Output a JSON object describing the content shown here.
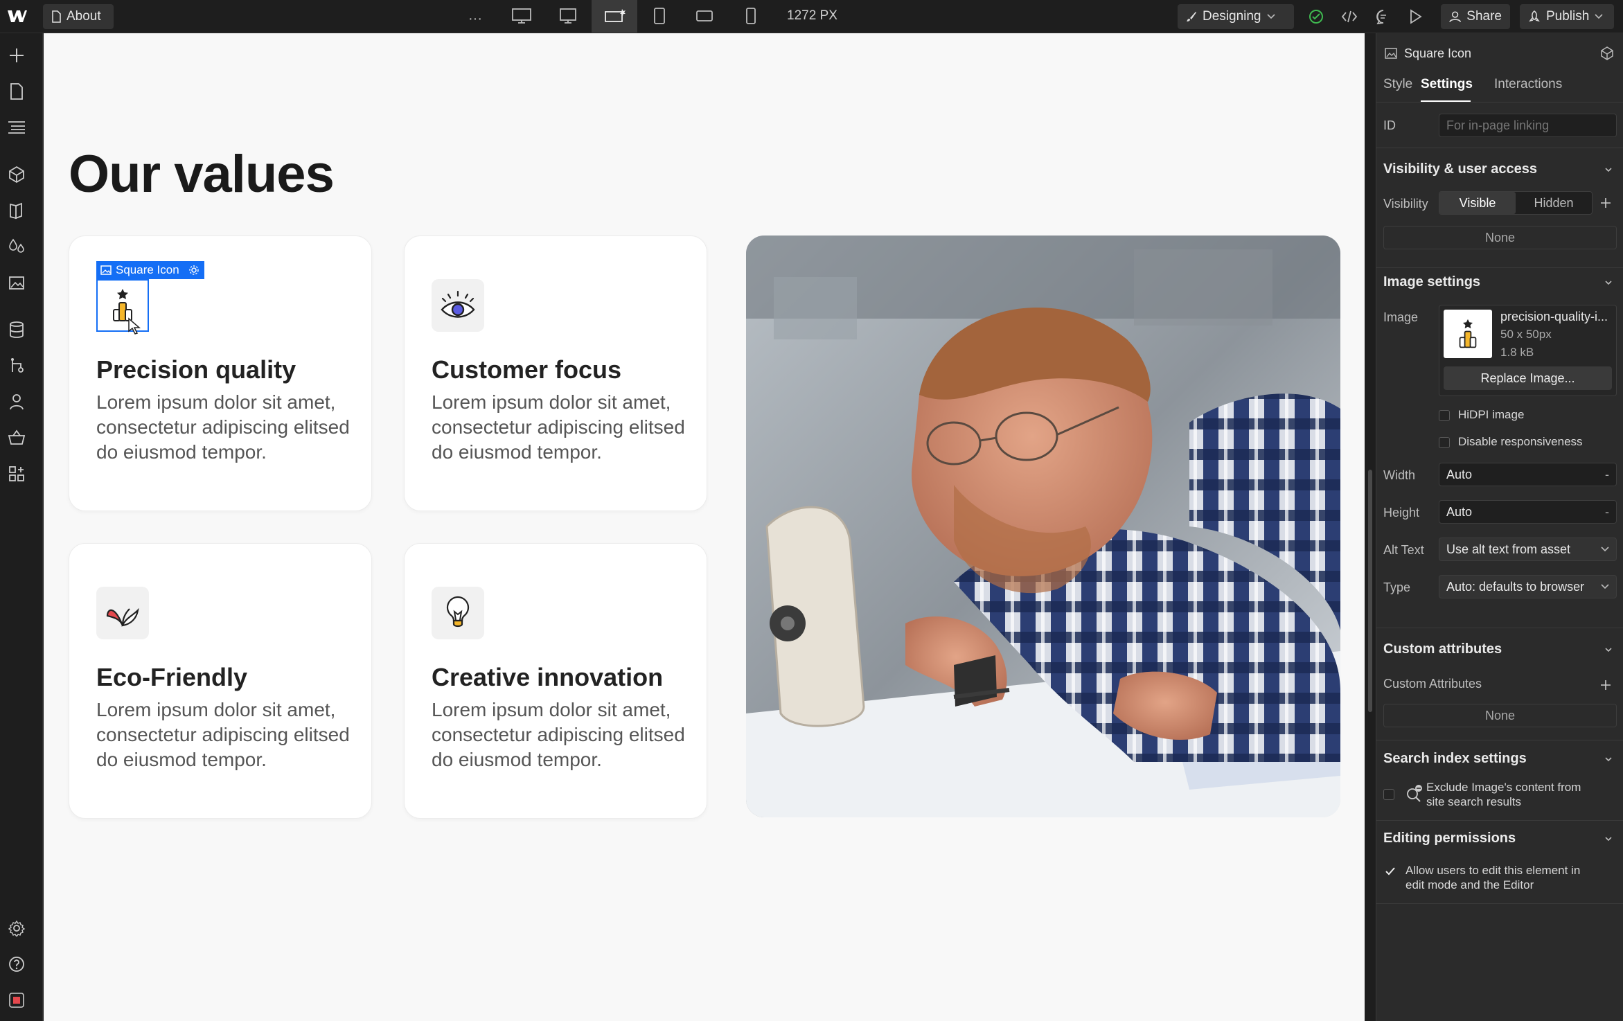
{
  "topbar": {
    "page_label": "About",
    "width_value": "1272",
    "width_unit": "PX",
    "mode_label": "Designing",
    "share_label": "Share",
    "publish_label": "Publish"
  },
  "canvas": {
    "title": "Our values",
    "selection_label": "Square Icon",
    "cards": [
      {
        "title": "Precision quality",
        "text": "Lorem ipsum dolor sit amet, consectetur adipiscing elitsed do eiusmod tempor.",
        "icon": "medal-bars-icon"
      },
      {
        "title": "Customer focus",
        "text": "Lorem ipsum dolor sit amet, consectetur adipiscing elitsed do eiusmod tempor.",
        "icon": "eye-icon"
      },
      {
        "title": "Eco-Friendly",
        "text": "Lorem ipsum dolor sit amet, consectetur adipiscing elitsed do eiusmod tempor.",
        "icon": "leaf-icon"
      },
      {
        "title": "Creative innovation",
        "text": "Lorem ipsum dolor sit amet, consectetur adipiscing elitsed do eiusmod tempor.",
        "icon": "lightbulb-icon"
      }
    ]
  },
  "panel": {
    "element_name": "Square Icon",
    "tabs": [
      "Style",
      "Settings",
      "Interactions"
    ],
    "id_label": "ID",
    "id_placeholder": "For in-page linking",
    "visibility": {
      "heading": "Visibility & user access",
      "label": "Visibility",
      "options": [
        "Visible",
        "Hidden"
      ],
      "none": "None"
    },
    "image": {
      "heading": "Image settings",
      "label": "Image",
      "file_name": "precision-quality-i...",
      "dimensions": "50 x 50px",
      "size": "1.8 kB",
      "replace_label": "Replace Image...",
      "hidpi_label": "HiDPI image",
      "disable_resp_label": "Disable responsiveness",
      "width_label": "Width",
      "width_value": "Auto",
      "height_label": "Height",
      "height_value": "Auto",
      "alt_label": "Alt Text",
      "alt_value": "Use alt text from asset",
      "type_label": "Type",
      "type_value": "Auto: defaults to browser"
    },
    "custom": {
      "heading": "Custom attributes",
      "label": "Custom Attributes",
      "none": "None"
    },
    "search": {
      "heading": "Search index settings",
      "text1": "Exclude Image's content from",
      "text2": "site search results"
    },
    "editing": {
      "heading": "Editing permissions",
      "text1": "Allow users to edit this element in",
      "text2": "edit mode and the Editor"
    }
  },
  "colors": {
    "accent": "#146ef5",
    "panel_bg": "#2b2b2b",
    "canvas_bg": "#f8f8f8",
    "status_green": "#3fb950"
  }
}
